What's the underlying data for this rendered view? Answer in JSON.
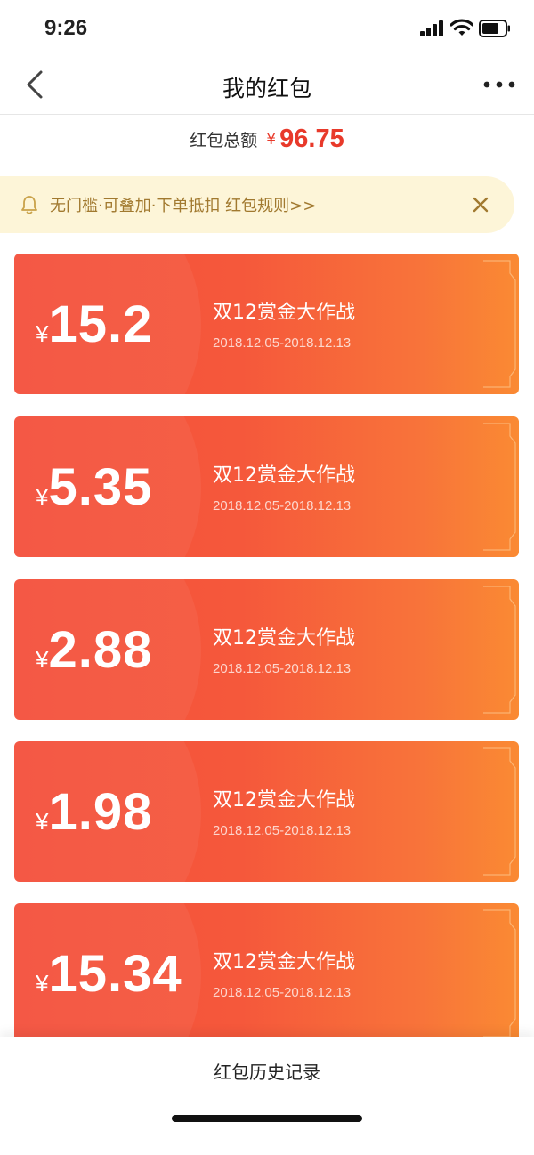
{
  "status_bar": {
    "time": "9:26"
  },
  "nav": {
    "title": "我的红包"
  },
  "total": {
    "label": "红包总额",
    "currency": "¥",
    "amount": "96.75"
  },
  "notice": {
    "text": "无门槛·可叠加·下单抵扣 红包规则>>"
  },
  "cards": [
    {
      "currency": "¥",
      "amount": "15.2",
      "name": "双12赏金大作战",
      "period": "2018.12.05-2018.12.13"
    },
    {
      "currency": "¥",
      "amount": "5.35",
      "name": "双12赏金大作战",
      "period": "2018.12.05-2018.12.13"
    },
    {
      "currency": "¥",
      "amount": "2.88",
      "name": "双12赏金大作战",
      "period": "2018.12.05-2018.12.13"
    },
    {
      "currency": "¥",
      "amount": "1.98",
      "name": "双12赏金大作战",
      "period": "2018.12.05-2018.12.13"
    },
    {
      "currency": "¥",
      "amount": "15.34",
      "name": "双12赏金大作战",
      "period": "2018.12.05-2018.12.13"
    }
  ],
  "footer": {
    "history_label": "红包历史记录"
  },
  "colors": {
    "accent": "#e8392a",
    "card_start": "#f4503c",
    "card_end": "#fa8a33",
    "notice_bg": "#fdf5d8",
    "notice_text": "#a1792f"
  },
  "icons": {
    "back": "chevron-left-icon",
    "more": "more-dots-icon",
    "bell": "bell-icon",
    "close": "close-icon"
  }
}
